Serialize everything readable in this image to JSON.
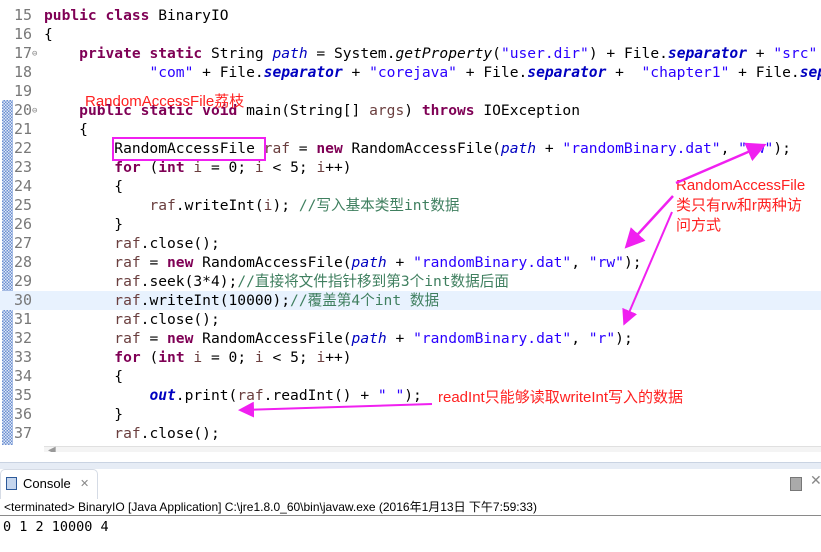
{
  "editor": {
    "lines": [
      {
        "n": "15",
        "t": [
          [
            "k",
            "public class "
          ],
          [
            "p",
            "BinaryIO"
          ]
        ]
      },
      {
        "n": "16",
        "t": [
          [
            "p",
            "{"
          ]
        ]
      },
      {
        "n": "17",
        "fold": true,
        "t": [
          [
            "p",
            "    "
          ],
          [
            "k",
            "private static "
          ],
          [
            "p",
            "String "
          ],
          [
            "pf",
            "path"
          ],
          [
            "p",
            " = System."
          ],
          [
            "i",
            "getProperty"
          ],
          [
            "p",
            "("
          ],
          [
            "s",
            "\"user.dir\""
          ],
          [
            "p",
            ") + File."
          ],
          [
            "f",
            "separator"
          ],
          [
            "p",
            " + "
          ],
          [
            "s",
            "\"src\""
          ]
        ]
      },
      {
        "n": "18",
        "t": [
          [
            "p",
            "            "
          ],
          [
            "s",
            "\"com\""
          ],
          [
            "p",
            " + File."
          ],
          [
            "f",
            "separator"
          ],
          [
            "p",
            " + "
          ],
          [
            "s",
            "\"corejava\""
          ],
          [
            "p",
            " + File."
          ],
          [
            "f",
            "separator"
          ],
          [
            "p",
            " +  "
          ],
          [
            "s",
            "\"chapter1\""
          ],
          [
            "p",
            " + File."
          ],
          [
            "f",
            "separator"
          ]
        ]
      },
      {
        "n": "19",
        "t": []
      },
      {
        "n": "20",
        "fold": true,
        "t": [
          [
            "p",
            "    "
          ],
          [
            "k",
            "public static void "
          ],
          [
            "p",
            "main(String[] "
          ],
          [
            "v",
            "args"
          ],
          [
            "p",
            ") "
          ],
          [
            "k",
            "throws "
          ],
          [
            "p",
            "IOException"
          ]
        ]
      },
      {
        "n": "21",
        "t": [
          [
            "p",
            "    {"
          ]
        ]
      },
      {
        "n": "22",
        "t": [
          [
            "p",
            "        RandomAccessFile "
          ],
          [
            "v",
            "raf"
          ],
          [
            "p",
            " = "
          ],
          [
            "k",
            "new "
          ],
          [
            "p",
            "RandomAccessFile("
          ],
          [
            "pf",
            "path"
          ],
          [
            "p",
            " + "
          ],
          [
            "s",
            "\"randomBinary.dat\""
          ],
          [
            "p",
            ", "
          ],
          [
            "s",
            "\"rw\""
          ],
          [
            "p",
            ");"
          ]
        ]
      },
      {
        "n": "23",
        "t": [
          [
            "p",
            "        "
          ],
          [
            "k",
            "for "
          ],
          [
            "p",
            "("
          ],
          [
            "k",
            "int "
          ],
          [
            "v",
            "i"
          ],
          [
            "p",
            " = 0; "
          ],
          [
            "v",
            "i"
          ],
          [
            "p",
            " < 5; "
          ],
          [
            "v",
            "i"
          ],
          [
            "p",
            "++)"
          ]
        ]
      },
      {
        "n": "24",
        "t": [
          [
            "p",
            "        {"
          ]
        ]
      },
      {
        "n": "25",
        "t": [
          [
            "p",
            "            "
          ],
          [
            "v",
            "raf"
          ],
          [
            "p",
            ".writeInt("
          ],
          [
            "v",
            "i"
          ],
          [
            "p",
            "); "
          ],
          [
            "c",
            "//写入基本类型int数据"
          ]
        ]
      },
      {
        "n": "26",
        "t": [
          [
            "p",
            "        }"
          ]
        ]
      },
      {
        "n": "27",
        "t": [
          [
            "p",
            "        "
          ],
          [
            "v",
            "raf"
          ],
          [
            "p",
            ".close();"
          ]
        ]
      },
      {
        "n": "28",
        "t": [
          [
            "p",
            "        "
          ],
          [
            "v",
            "raf"
          ],
          [
            "p",
            " = "
          ],
          [
            "k",
            "new "
          ],
          [
            "p",
            "RandomAccessFile("
          ],
          [
            "pf",
            "path"
          ],
          [
            "p",
            " + "
          ],
          [
            "s",
            "\"randomBinary.dat\""
          ],
          [
            "p",
            ", "
          ],
          [
            "s",
            "\"rw\""
          ],
          [
            "p",
            ");"
          ]
        ]
      },
      {
        "n": "29",
        "t": [
          [
            "p",
            "        "
          ],
          [
            "v",
            "raf"
          ],
          [
            "p",
            ".seek(3*4);"
          ],
          [
            "c",
            "//直接将文件指针移到第3个int数据后面"
          ]
        ]
      },
      {
        "n": "30",
        "hl": true,
        "t": [
          [
            "p",
            "        "
          ],
          [
            "v",
            "raf"
          ],
          [
            "p",
            ".writeInt(10000);"
          ],
          [
            "c",
            "//覆盖第4个int 数据"
          ]
        ]
      },
      {
        "n": "31",
        "t": [
          [
            "p",
            "        "
          ],
          [
            "v",
            "raf"
          ],
          [
            "p",
            ".close();"
          ]
        ]
      },
      {
        "n": "32",
        "t": [
          [
            "p",
            "        "
          ],
          [
            "v",
            "raf"
          ],
          [
            "p",
            " = "
          ],
          [
            "k",
            "new "
          ],
          [
            "p",
            "RandomAccessFile("
          ],
          [
            "pf",
            "path"
          ],
          [
            "p",
            " + "
          ],
          [
            "s",
            "\"randomBinary.dat\""
          ],
          [
            "p",
            ", "
          ],
          [
            "s",
            "\"r\""
          ],
          [
            "p",
            ");"
          ]
        ]
      },
      {
        "n": "33",
        "t": [
          [
            "p",
            "        "
          ],
          [
            "k",
            "for "
          ],
          [
            "p",
            "("
          ],
          [
            "k",
            "int "
          ],
          [
            "v",
            "i"
          ],
          [
            "p",
            " = 0; "
          ],
          [
            "v",
            "i"
          ],
          [
            "p",
            " < 5; "
          ],
          [
            "v",
            "i"
          ],
          [
            "p",
            "++)"
          ]
        ]
      },
      {
        "n": "34",
        "t": [
          [
            "p",
            "        {"
          ]
        ]
      },
      {
        "n": "35",
        "t": [
          [
            "p",
            "            "
          ],
          [
            "f",
            "out"
          ],
          [
            "p",
            "."
          ],
          [
            "p",
            "print("
          ],
          [
            "v",
            "raf"
          ],
          [
            "p",
            ".readInt() + "
          ],
          [
            "s",
            "\" \""
          ],
          [
            "p",
            ");"
          ]
        ]
      },
      {
        "n": "36",
        "t": [
          [
            "p",
            "        }"
          ]
        ]
      },
      {
        "n": "37",
        "t": [
          [
            "p",
            "        "
          ],
          [
            "v",
            "raf"
          ],
          [
            "p",
            ".close();"
          ]
        ]
      }
    ]
  },
  "annotations": {
    "title": "RandomAccessFile荔枝",
    "access_modes": "RandomAccessFile\n类只有rw和r两种访\n问方式",
    "readint": "readInt只能够读取writeInt写入的数据",
    "color": "#f020f0"
  },
  "console": {
    "tab_label": "Console",
    "close_icon": "✕",
    "status": "<terminated> BinaryIO [Java Application] C:\\jre1.8.0_60\\bin\\javaw.exe (2016年1月13日 下午7:59:33)",
    "output": "0 1 2 10000 4"
  }
}
